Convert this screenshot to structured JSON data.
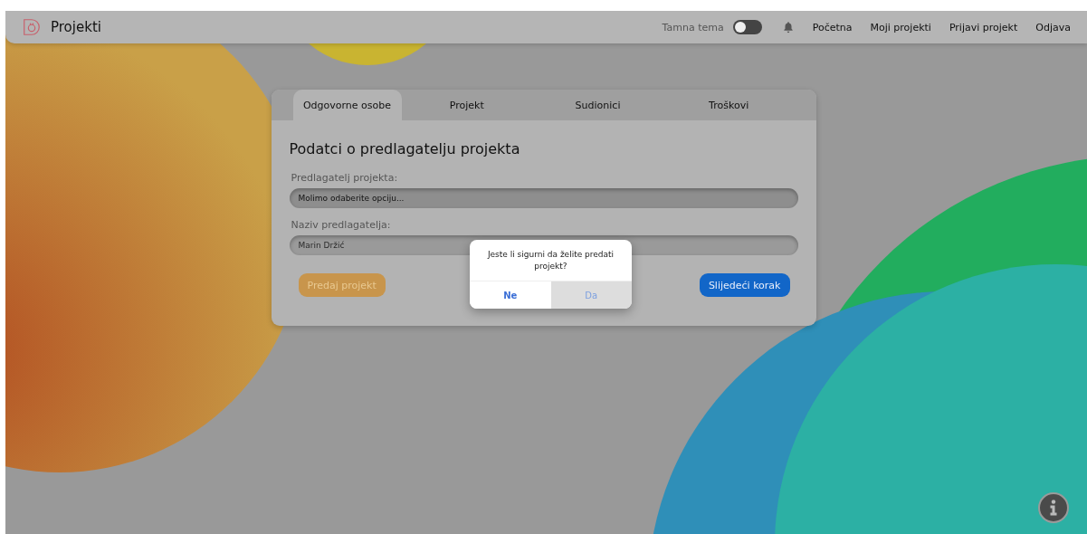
{
  "navbar": {
    "title": "Projekti",
    "theme_toggle": {
      "label": "Tamna tema",
      "on": false
    },
    "links": [
      "Početna",
      "Moji projekti",
      "Prijavi projekt",
      "Odjava"
    ]
  },
  "tabs": [
    {
      "label": "Odgovorne osobe",
      "selected": true
    },
    {
      "label": "Projekt",
      "selected": false
    },
    {
      "label": "Sudionici",
      "selected": false
    },
    {
      "label": "Troškovi",
      "selected": false
    }
  ],
  "form": {
    "heading": "Podatci o predlagatelju projekta",
    "fields": [
      {
        "label": "Predlagatelj projekta:",
        "value": "Molimo odaberite opciju...",
        "disabled": false
      },
      {
        "label": "Naziv predlagatelja:",
        "value": "Marin Držić",
        "disabled": true
      }
    ],
    "submit_button": "Predaj projekt",
    "next_button": "Slijedeći korak"
  },
  "dialog": {
    "message": "Jeste li sigurni da želite predati projekt?",
    "buttons": [
      {
        "label": "Ne",
        "selected": false
      },
      {
        "label": "Da",
        "selected": true
      }
    ]
  }
}
